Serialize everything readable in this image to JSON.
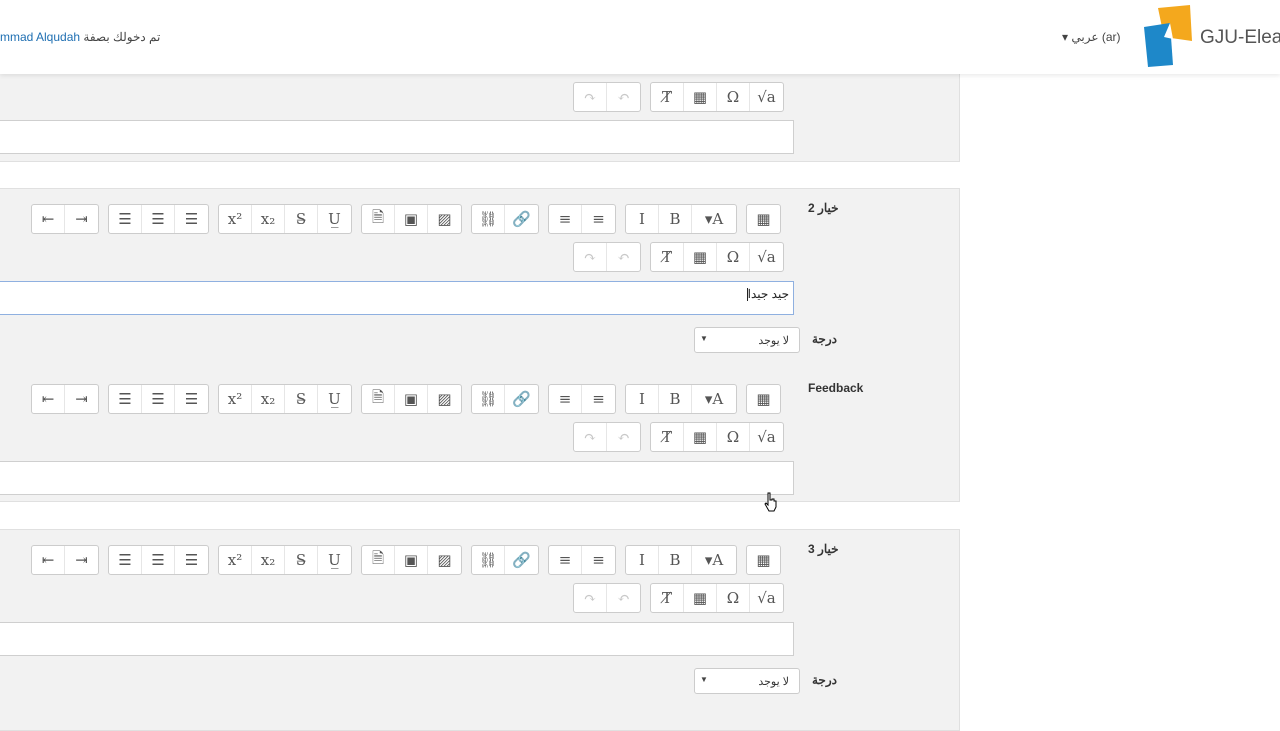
{
  "header": {
    "logged_in_prefix": "تم دخولك بصفة",
    "user_name": "mmad Alqudah",
    "language": "عربي (ar)",
    "brand": "GJU-Elea"
  },
  "toolbar_row1": [
    "outdent-icon",
    "indent-icon",
    "align-right-icon",
    "align-center-icon",
    "align-left-icon",
    "superscript-icon",
    "subscript-icon",
    "strikethrough-icon",
    "underline-icon",
    "manage-files-icon",
    "media-icon",
    "image-icon",
    "unlink-icon",
    "link-icon",
    "ordered-list-icon",
    "unordered-list-icon",
    "italic-icon",
    "bold-icon",
    "font-color-icon",
    "toolbar-toggle-icon"
  ],
  "toolbar_row2": [
    "redo-icon",
    "undo-icon",
    "clear-formatting-icon",
    "table-icon",
    "special-char-icon",
    "equation-icon"
  ],
  "sections": {
    "choice2": {
      "label": "خيار 2",
      "answer_text": "جيد جيدا"
    },
    "grade": {
      "label": "درجة",
      "value": "لا يوجد"
    },
    "feedback": {
      "label": "Feedback"
    },
    "choice3": {
      "label": "خيار 3"
    },
    "grade3": {
      "label": "درجة",
      "value": "لا يوجد"
    }
  }
}
